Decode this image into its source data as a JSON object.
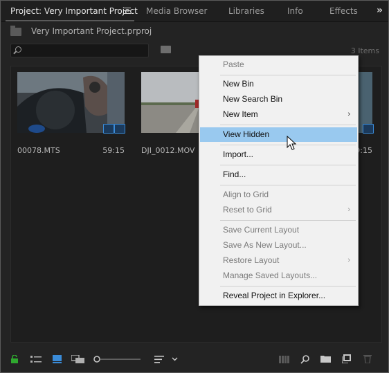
{
  "tabs": [
    {
      "label": "Project: Very Important Project",
      "active": true
    },
    {
      "label": "Media Browser",
      "active": false
    },
    {
      "label": "Libraries",
      "active": false
    },
    {
      "label": "Info",
      "active": false
    },
    {
      "label": "Effects",
      "active": false
    }
  ],
  "tab_overflow": "»",
  "project_path": "Very Important Project.prproj",
  "search": {
    "value": "",
    "placeholder": ""
  },
  "item_count": "3 Items",
  "clips": [
    {
      "name": "00078.MTS",
      "duration": "59:15"
    },
    {
      "name": "DJI_0012.MOV",
      "duration": ""
    },
    {
      "name": "",
      "duration": "59:15"
    }
  ],
  "context_menu": {
    "items": [
      {
        "label": "Paste",
        "enabled": false
      },
      {
        "label": "New Bin",
        "enabled": true
      },
      {
        "label": "New Search Bin",
        "enabled": true
      },
      {
        "label": "New Item",
        "enabled": true,
        "submenu": true
      },
      {
        "label": "View Hidden",
        "enabled": true,
        "highlighted": true
      },
      {
        "label": "Import...",
        "enabled": true
      },
      {
        "label": "Find...",
        "enabled": true
      },
      {
        "label": "Align to Grid",
        "enabled": false
      },
      {
        "label": "Reset to Grid",
        "enabled": false,
        "submenu": true
      },
      {
        "label": "Save Current Layout",
        "enabled": false
      },
      {
        "label": "Save As New Layout...",
        "enabled": false
      },
      {
        "label": "Restore Layout",
        "enabled": false,
        "submenu": true
      },
      {
        "label": "Manage Saved Layouts...",
        "enabled": false
      },
      {
        "label": "Reveal Project in Explorer...",
        "enabled": true
      }
    ],
    "submenu_glyph": "›"
  },
  "colors": {
    "accent": "#3a8bd8",
    "highlight": "#99c9ef",
    "lock": "#2fa82f"
  }
}
